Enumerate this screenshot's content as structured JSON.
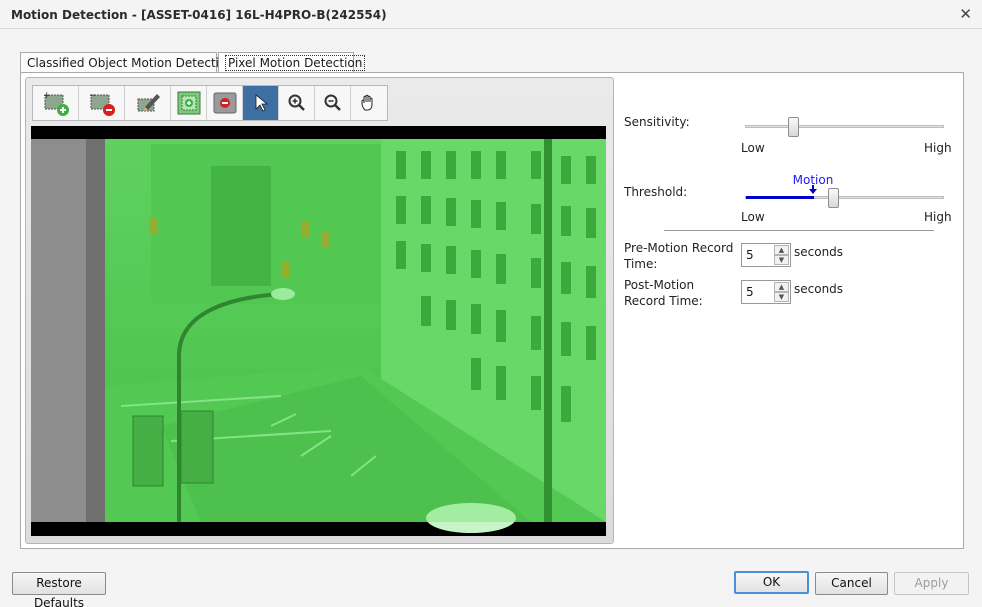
{
  "window": {
    "title": "Motion Detection - [ASSET-0416] 16L-H4PRO-B(242554)"
  },
  "tabs": [
    {
      "label": "Classified Object Motion Detection"
    },
    {
      "label": "Pixel Motion Detection"
    }
  ],
  "toolbar": {
    "icons": [
      "add-region-icon",
      "remove-region-icon",
      "draw-region-icon",
      "select-all-region-icon",
      "clear-region-icon",
      "pointer-icon",
      "zoom-in-icon",
      "zoom-out-icon",
      "pan-hand-icon"
    ],
    "active": "pointer-icon"
  },
  "video": {
    "overlay_color": "#33d633"
  },
  "settings": {
    "sensitivity_label": "Sensitivity:",
    "sensitivity_low": "Low",
    "sensitivity_high": "High",
    "sensitivity_level": 0.24,
    "threshold_label": "Threshold:",
    "motion_label": "Motion",
    "threshold_low": "Low",
    "threshold_high": "High",
    "motion_level": 0.34,
    "threshold_level": 0.44,
    "pre_label_1": "Pre-Motion Record",
    "pre_label_2": "Time:",
    "pre_value": "5",
    "pre_unit": "seconds",
    "post_label_1": "Post-Motion",
    "post_label_2": "Record Time:",
    "post_value": "5",
    "post_unit": "seconds"
  },
  "buttons": {
    "restore": "Restore Defaults",
    "ok": "OK",
    "cancel": "Cancel",
    "apply": "Apply"
  },
  "colors": {
    "accent": "#3d6fa3",
    "motion_bar": "#0000cc",
    "motion_text": "#1a1aff"
  }
}
